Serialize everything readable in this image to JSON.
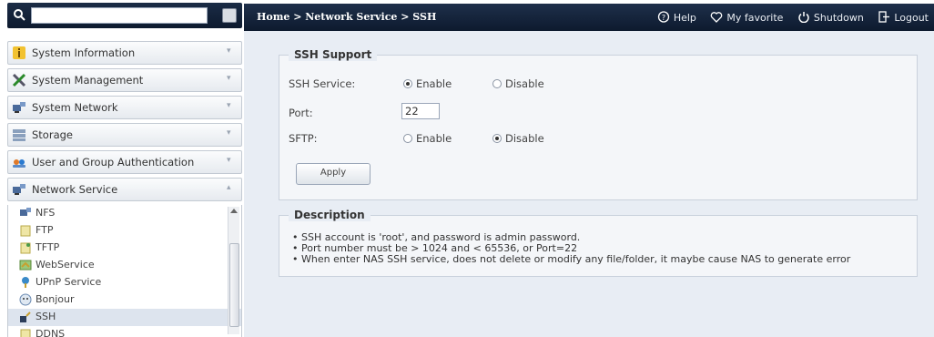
{
  "search": {
    "value": "",
    "placeholder": ""
  },
  "menu": [
    {
      "label": "System Information",
      "icon": "info-icon"
    },
    {
      "label": "System Management",
      "icon": "tools-icon"
    },
    {
      "label": "System Network",
      "icon": "network-icon"
    },
    {
      "label": "Storage",
      "icon": "storage-icon"
    },
    {
      "label": "User and Group Authentication",
      "icon": "users-icon"
    },
    {
      "label": "Network Service",
      "icon": "network-service-icon"
    }
  ],
  "submenu": [
    {
      "label": "NFS",
      "icon": "nfs-icon"
    },
    {
      "label": "FTP",
      "icon": "ftp-icon"
    },
    {
      "label": "TFTP",
      "icon": "tftp-icon"
    },
    {
      "label": "WebService",
      "icon": "webservice-icon"
    },
    {
      "label": "UPnP Service",
      "icon": "upnp-icon"
    },
    {
      "label": "Bonjour",
      "icon": "bonjour-icon"
    },
    {
      "label": "SSH",
      "icon": "ssh-icon",
      "selected": true
    },
    {
      "label": "DDNS",
      "icon": "ddns-icon"
    }
  ],
  "topbar": {
    "breadcrumb": "Home > Network Service > SSH",
    "help": "Help",
    "favorite": "My favorite",
    "shutdown": "Shutdown",
    "logout": "Logout"
  },
  "ssh": {
    "legend": "SSH Support",
    "service_label": "SSH Service:",
    "enable": "Enable",
    "disable": "Disable",
    "service_value": "Enable",
    "port_label": "Port:",
    "port_value": "22",
    "sftp_label": "SFTP:",
    "sftp_value": "Disable",
    "apply": "Apply"
  },
  "description": {
    "legend": "Description",
    "items": [
      "SSH account is 'root', and password is admin password.",
      "Port number must be > 1024 and < 65536, or Port=22",
      "When enter NAS SSH service, does not delete or modify any file/folder, it maybe cause NAS to generate error"
    ]
  },
  "colors": {
    "topbar": "#13233b",
    "content_bg": "#e8edf4",
    "selected_row": "#dde4ee"
  }
}
